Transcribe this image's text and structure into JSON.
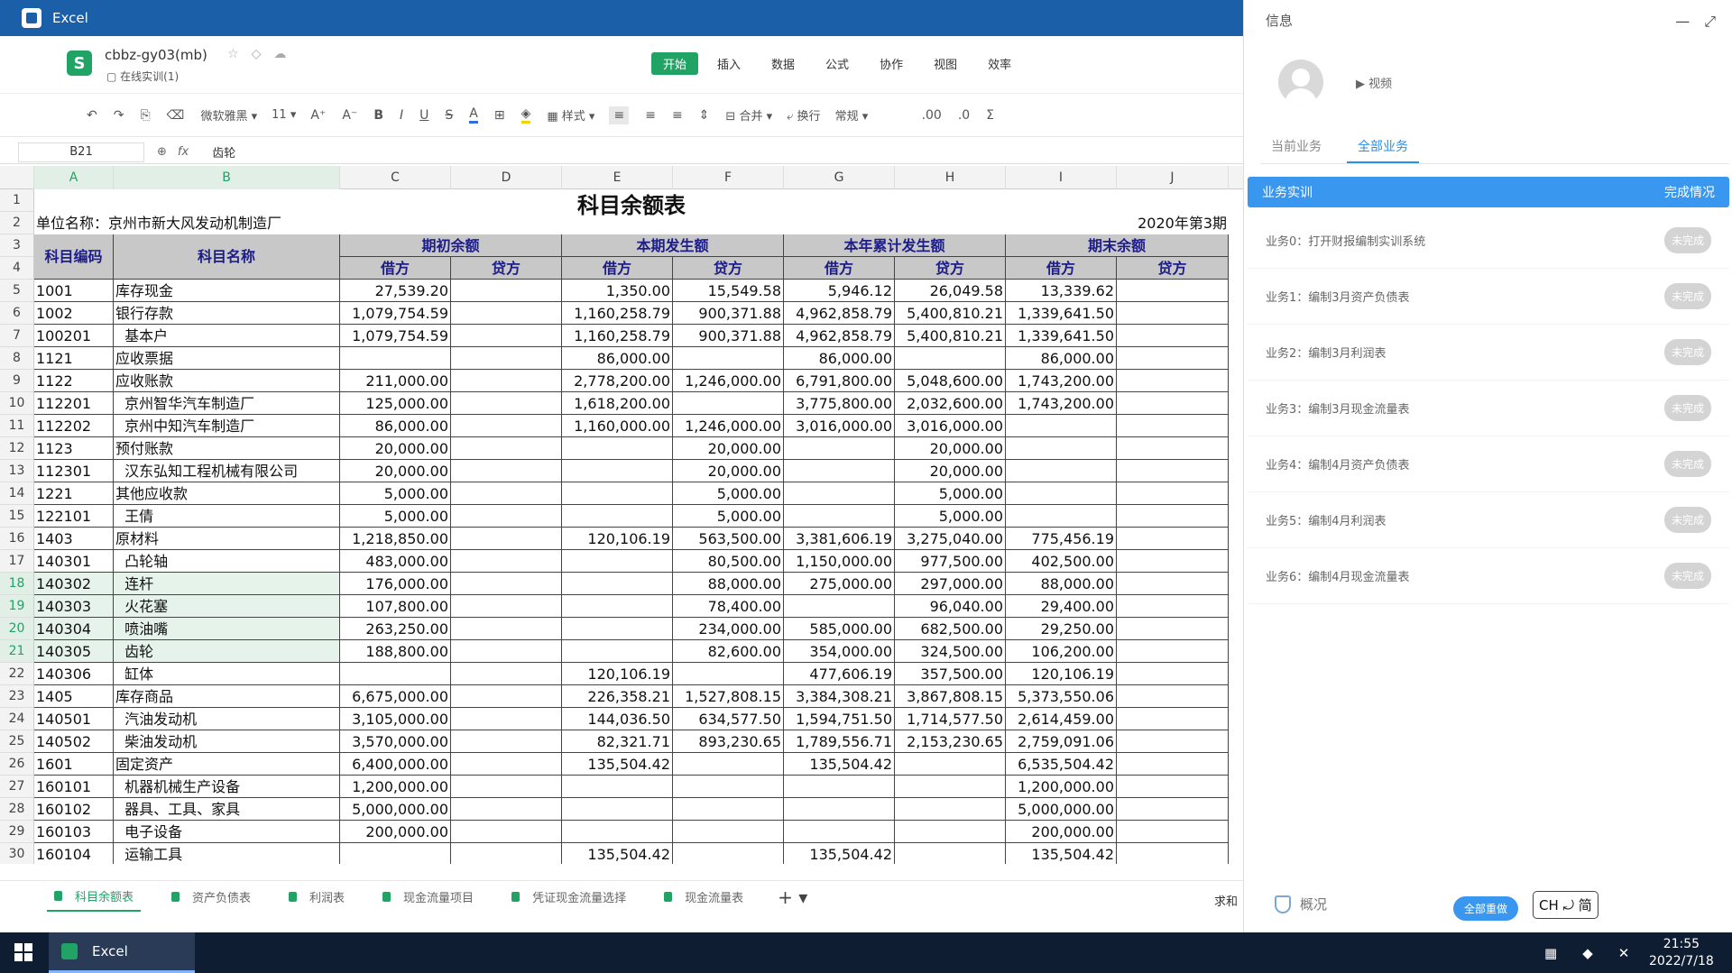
{
  "titlebar": {
    "title": "Excel"
  },
  "file": {
    "name": "cbbz-gy03(mb)",
    "location": "在线实训(1)"
  },
  "menu": {
    "tabs": [
      "开始",
      "插入",
      "数据",
      "公式",
      "协作",
      "视图",
      "效率"
    ]
  },
  "toolbar": {
    "font": "微软雅黑",
    "size": "11",
    "style_label": "样式",
    "merge_label": "合并",
    "wrap_label": "换行",
    "format": "常规"
  },
  "formula": {
    "ref": "B21",
    "value": "齿轮"
  },
  "columns": [
    "A",
    "B",
    "C",
    "D",
    "E",
    "F",
    "G",
    "H",
    "I",
    "J"
  ],
  "sheet": {
    "title": "科目余额表",
    "unit": "单位名称：京州市新大风发动机制造厂",
    "period": "2020年第3期",
    "h_code": "科目编码",
    "h_name": "科目名称",
    "h_groups": [
      "期初余额",
      "本期发生额",
      "本年累计发生额",
      "期末余额"
    ],
    "h_sub": [
      "借方",
      "贷方",
      "借方",
      "贷方",
      "借方",
      "贷方",
      "借方",
      "贷方"
    ],
    "rows": [
      [
        "1001",
        "库存现金",
        "27,539.20",
        "",
        "1,350.00",
        "15,549.58",
        "5,946.12",
        "26,049.58",
        "13,339.62",
        ""
      ],
      [
        "1002",
        "银行存款",
        "1,079,754.59",
        "",
        "1,160,258.79",
        "900,371.88",
        "4,962,858.79",
        "5,400,810.21",
        "1,339,641.50",
        ""
      ],
      [
        "100201",
        "  基本户",
        "1,079,754.59",
        "",
        "1,160,258.79",
        "900,371.88",
        "4,962,858.79",
        "5,400,810.21",
        "1,339,641.50",
        ""
      ],
      [
        "1121",
        "应收票据",
        "",
        "",
        "86,000.00",
        "",
        "86,000.00",
        "",
        "86,000.00",
        ""
      ],
      [
        "1122",
        "应收账款",
        "211,000.00",
        "",
        "2,778,200.00",
        "1,246,000.00",
        "6,791,800.00",
        "5,048,600.00",
        "1,743,200.00",
        ""
      ],
      [
        "112201",
        "  京州智华汽车制造厂",
        "125,000.00",
        "",
        "1,618,200.00",
        "",
        "3,775,800.00",
        "2,032,600.00",
        "1,743,200.00",
        ""
      ],
      [
        "112202",
        "  京州中知汽车制造厂",
        "86,000.00",
        "",
        "1,160,000.00",
        "1,246,000.00",
        "3,016,000.00",
        "3,016,000.00",
        "",
        ""
      ],
      [
        "1123",
        "预付账款",
        "20,000.00",
        "",
        "",
        "20,000.00",
        "",
        "20,000.00",
        "",
        ""
      ],
      [
        "112301",
        "  汉东弘知工程机械有限公司",
        "20,000.00",
        "",
        "",
        "20,000.00",
        "",
        "20,000.00",
        "",
        ""
      ],
      [
        "1221",
        "其他应收款",
        "5,000.00",
        "",
        "",
        "5,000.00",
        "",
        "5,000.00",
        "",
        ""
      ],
      [
        "122101",
        "  王倩",
        "5,000.00",
        "",
        "",
        "5,000.00",
        "",
        "5,000.00",
        "",
        ""
      ],
      [
        "1403",
        "原材料",
        "1,218,850.00",
        "",
        "120,106.19",
        "563,500.00",
        "3,381,606.19",
        "3,275,040.00",
        "775,456.19",
        ""
      ],
      [
        "140301",
        "  凸轮轴",
        "483,000.00",
        "",
        "",
        "80,500.00",
        "1,150,000.00",
        "977,500.00",
        "402,500.00",
        ""
      ],
      [
        "140302",
        "  连杆",
        "176,000.00",
        "",
        "",
        "88,000.00",
        "275,000.00",
        "297,000.00",
        "88,000.00",
        ""
      ],
      [
        "140303",
        "  火花塞",
        "107,800.00",
        "",
        "",
        "78,400.00",
        "",
        "96,040.00",
        "29,400.00",
        ""
      ],
      [
        "140304",
        "  喷油嘴",
        "263,250.00",
        "",
        "",
        "234,000.00",
        "585,000.00",
        "682,500.00",
        "29,250.00",
        ""
      ],
      [
        "140305",
        "  齿轮",
        "188,800.00",
        "",
        "",
        "82,600.00",
        "354,000.00",
        "324,500.00",
        "106,200.00",
        ""
      ],
      [
        "140306",
        "  缸体",
        "",
        "",
        "120,106.19",
        "",
        "477,606.19",
        "357,500.00",
        "120,106.19",
        ""
      ],
      [
        "1405",
        "库存商品",
        "6,675,000.00",
        "",
        "226,358.21",
        "1,527,808.15",
        "3,384,308.21",
        "3,867,808.15",
        "5,373,550.06",
        ""
      ],
      [
        "140501",
        "  汽油发动机",
        "3,105,000.00",
        "",
        "144,036.50",
        "634,577.50",
        "1,594,751.50",
        "1,714,577.50",
        "2,614,459.00",
        ""
      ],
      [
        "140502",
        "  柴油发动机",
        "3,570,000.00",
        "",
        "82,321.71",
        "893,230.65",
        "1,789,556.71",
        "2,153,230.65",
        "2,759,091.06",
        ""
      ],
      [
        "1601",
        "固定资产",
        "6,400,000.00",
        "",
        "135,504.42",
        "",
        "135,504.42",
        "",
        "6,535,504.42",
        ""
      ],
      [
        "160101",
        "  机器机械生产设备",
        "1,200,000.00",
        "",
        "",
        "",
        "",
        "",
        "1,200,000.00",
        ""
      ],
      [
        "160102",
        "  器具、工具、家具",
        "5,000,000.00",
        "",
        "",
        "",
        "",
        "",
        "5,000,000.00",
        ""
      ],
      [
        "160103",
        "  电子设备",
        "200,000.00",
        "",
        "",
        "",
        "",
        "",
        "200,000.00",
        ""
      ],
      [
        "160104",
        "  运输工具",
        "",
        "",
        "135,504.42",
        "",
        "135,504.42",
        "",
        "135,504.42",
        ""
      ]
    ]
  },
  "row_numbers": [
    "1",
    "2",
    "3",
    "4",
    "5",
    "6",
    "7",
    "8",
    "9",
    "10",
    "11",
    "12",
    "13",
    "14",
    "15",
    "16",
    "17",
    "18",
    "19",
    "20",
    "21",
    "22",
    "23",
    "24",
    "25",
    "26",
    "27",
    "28",
    "29",
    "30"
  ],
  "sheet_tabs": [
    "科目余额表",
    "资产负债表",
    "利润表",
    "现金流量项目",
    "凭证现金流量选择",
    "现金流量表"
  ],
  "status": {
    "sum": "求和"
  },
  "panel": {
    "title": "信息",
    "video": "视频",
    "tabs": [
      "当前业务",
      "全部业务"
    ],
    "head_left": "业务实训",
    "head_right": "完成情况",
    "tasks": [
      {
        "label": "业务0：打开财报编制实训系统",
        "status": "未完成"
      },
      {
        "label": "业务1：编制3月资产负债表",
        "status": "未完成"
      },
      {
        "label": "业务2：编制3月利润表",
        "status": "未完成"
      },
      {
        "label": "业务3：编制3月现金流量表",
        "status": "未完成"
      },
      {
        "label": "业务4：编制4月资产负债表",
        "status": "未完成"
      },
      {
        "label": "业务5：编制4月利润表",
        "status": "未完成"
      },
      {
        "label": "业务6：编制4月现金流量表",
        "status": "未完成"
      }
    ],
    "overview": "概况",
    "redo": "全部重做",
    "ime": "CH ⤾ 简"
  },
  "taskbar": {
    "app": "Excel",
    "time": "21:55",
    "date": "2022/7/18"
  }
}
